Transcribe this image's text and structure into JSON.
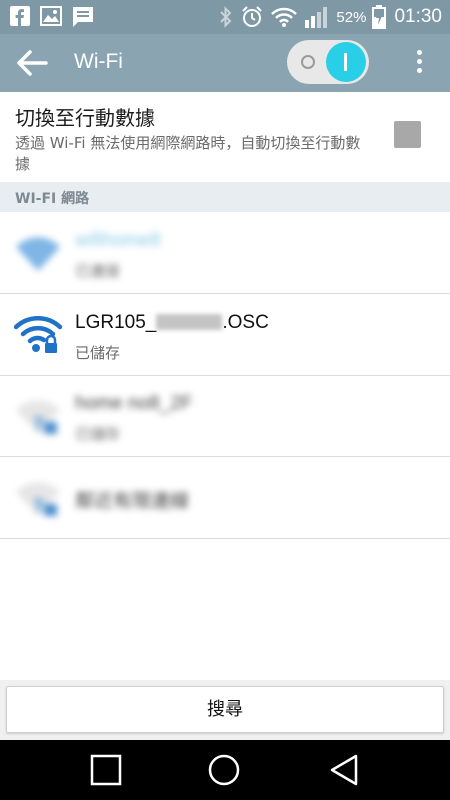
{
  "status_bar": {
    "notification_icons": [
      "facebook-icon",
      "gallery-icon",
      "message-icon"
    ],
    "system_icons": [
      "bluetooth-icon",
      "alarm-icon",
      "wifi-signal-icon",
      "cell-signal-icon",
      "battery-charging-icon"
    ],
    "battery_percent": "52%",
    "time": "01:30"
  },
  "app_bar": {
    "title": "Wi-Fi",
    "wifi_enabled": true
  },
  "switch_to_mobile": {
    "title": "切換至行動數據",
    "description": "透過 Wi-Fi 無法使用網際網路時，自動切換至行動數據",
    "checked": false
  },
  "section": {
    "header": "WI-FI 網路"
  },
  "networks": [
    {
      "name": "wifihome8",
      "status": "已連接",
      "blurred": true,
      "secured": false,
      "color": "#7fb6e6"
    },
    {
      "name_prefix": "LGR105_",
      "name_suffix": ".OSC",
      "status": "已儲存",
      "blurred": false,
      "secured": true,
      "color": "#1e72c8"
    },
    {
      "name": "home no8_2F",
      "status": "已儲存",
      "blurred": true,
      "secured": true,
      "color": "#8fb9de"
    },
    {
      "name": "鄰近有限連線",
      "status": "",
      "blurred": true,
      "secured": true,
      "color": "#8fb9de"
    }
  ],
  "actions": {
    "search_label": "搜尋"
  },
  "colors": {
    "status_bar": "#7e98a5",
    "app_bar": "#8aa4b1",
    "toggle_accent": "#29cfe6",
    "wifi_blue": "#1e72c8",
    "section_bg": "#e8edf1"
  }
}
